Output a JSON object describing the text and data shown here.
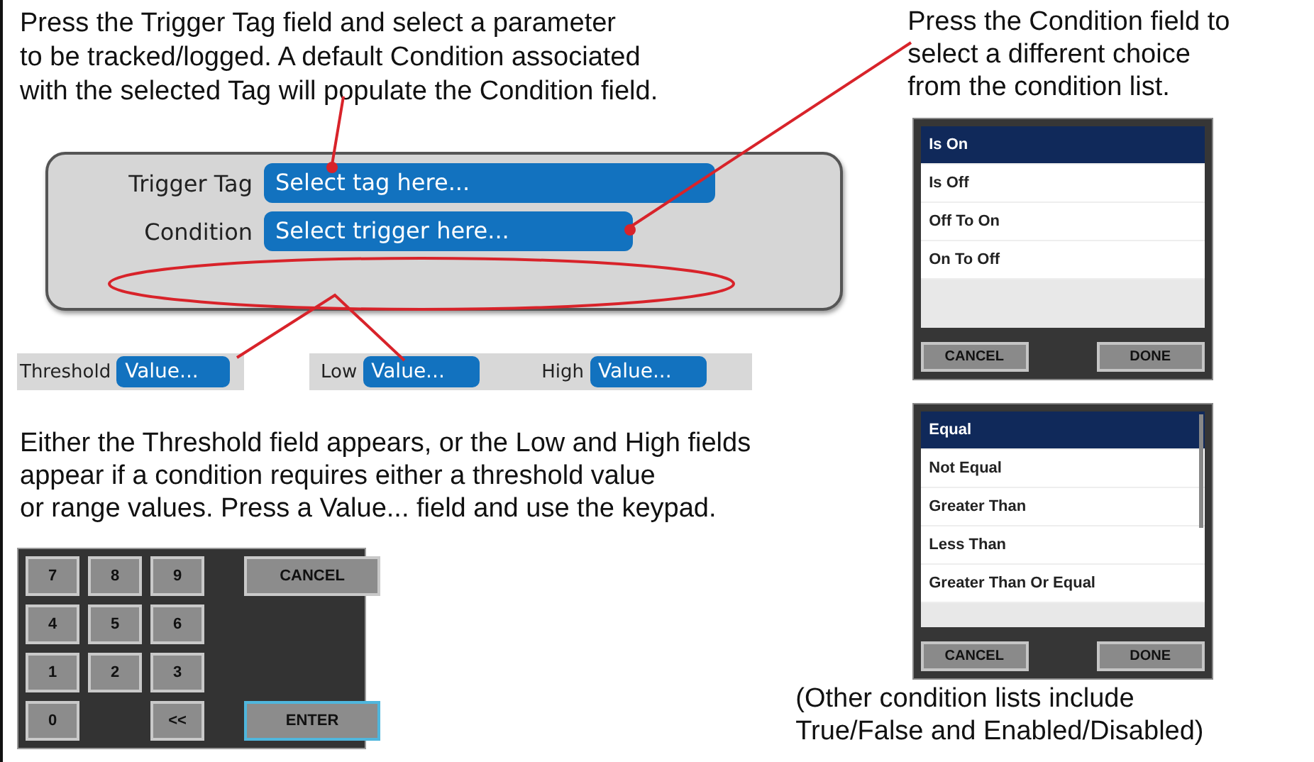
{
  "top_note": "Press the Trigger Tag field and select a parameter\nto be tracked/logged. A default Condition associated\nwith the selected Tag will populate the Condition field.",
  "trigger_panel": {
    "fields": [
      {
        "label": "Trigger Tag",
        "placeholder": "Select tag here..."
      },
      {
        "label": "Condition",
        "placeholder": "Select trigger here..."
      }
    ]
  },
  "threshold_field": {
    "label": "Threshold",
    "placeholder": "Value..."
  },
  "range_fields": [
    {
      "label": "Low",
      "placeholder": "Value..."
    },
    {
      "label": "High",
      "placeholder": "Value..."
    }
  ],
  "middle_note": "Either the Threshold field appears, or the Low and High fields\nappear if a condition requires either a threshold value\nor range values. Press a Value... field and use the keypad.",
  "keypad": {
    "rows": [
      {
        "keys": [
          {
            "kind": "key",
            "label": "7"
          },
          {
            "kind": "key",
            "label": "8"
          },
          {
            "kind": "key",
            "label": "9"
          }
        ],
        "action": {
          "label": "CANCEL",
          "focused": false
        }
      },
      {
        "keys": [
          {
            "kind": "key",
            "label": "4"
          },
          {
            "kind": "key",
            "label": "5"
          },
          {
            "kind": "key",
            "label": "6"
          }
        ]
      },
      {
        "keys": [
          {
            "kind": "key",
            "label": "1"
          },
          {
            "kind": "key",
            "label": "2"
          },
          {
            "kind": "key",
            "label": "3"
          }
        ]
      },
      {
        "keys": [
          {
            "kind": "key",
            "label": "0"
          },
          {
            "kind": "gap"
          },
          {
            "kind": "key",
            "label": "<<"
          }
        ],
        "action": {
          "label": "ENTER",
          "focused": true
        }
      }
    ]
  },
  "side_note": "Press the Condition field to\nselect a different choice\nfrom the condition list.",
  "condition_lists": [
    {
      "scrollbar": false,
      "items": [
        {
          "label": "Is On",
          "selected": true
        },
        {
          "label": "Is Off",
          "selected": false
        },
        {
          "label": "Off To On",
          "selected": false
        },
        {
          "label": "On To Off",
          "selected": false
        }
      ],
      "buttons": [
        "CANCEL",
        "DONE"
      ]
    },
    {
      "scrollbar": true,
      "items": [
        {
          "label": "Equal",
          "selected": true
        },
        {
          "label": "Not Equal",
          "selected": false
        },
        {
          "label": "Greater Than",
          "selected": false
        },
        {
          "label": "Less Than",
          "selected": false
        },
        {
          "label": "Greater Than Or Equal",
          "selected": false
        }
      ],
      "buttons": [
        "CANCEL",
        "DONE"
      ]
    }
  ],
  "caption": "(Other condition lists include\nTrue/False and Enabled/Disabled)"
}
